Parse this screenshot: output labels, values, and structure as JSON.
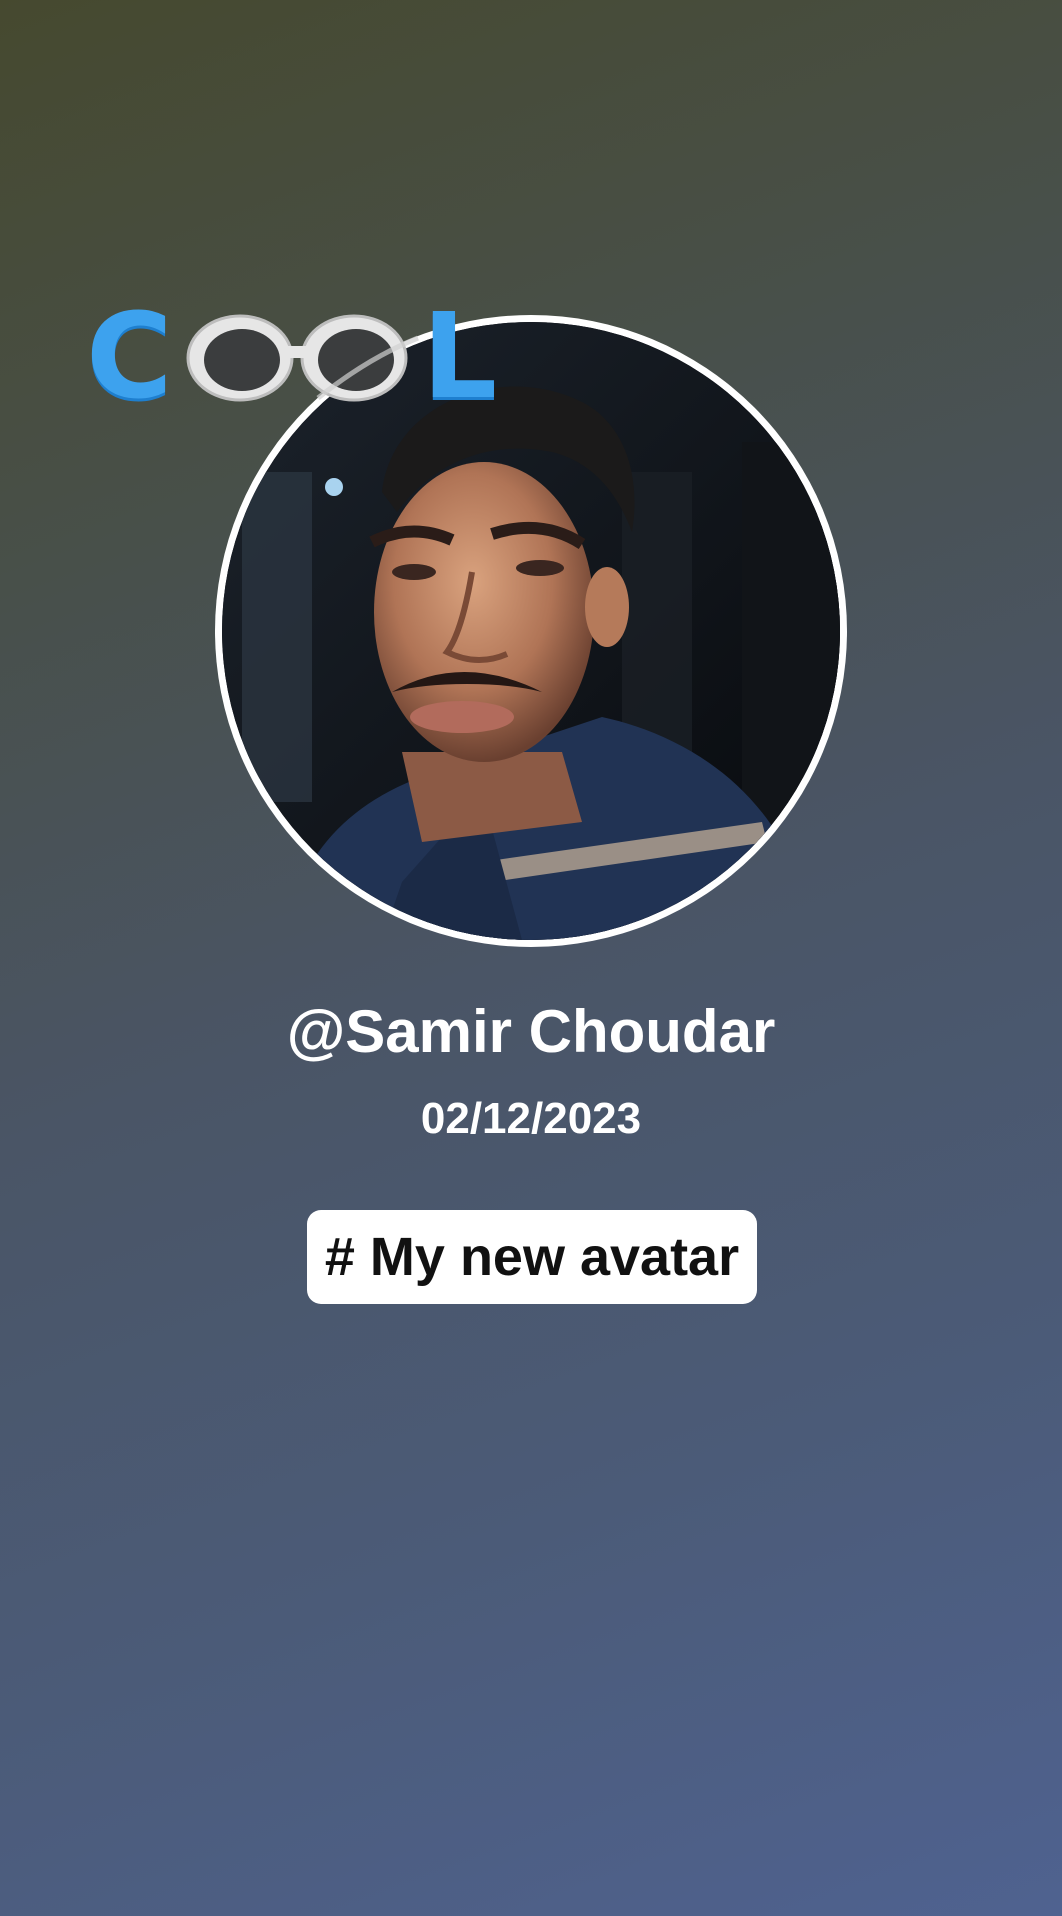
{
  "profile": {
    "username": "@Samir Choudar",
    "date": "02/12/2023",
    "avatar_icon": "user-photo",
    "ring_color": "#ffffff"
  },
  "sticker": {
    "icon": "sunglasses-icon",
    "letter_first": "C",
    "letter_last": "L",
    "color": "#3da2ee"
  },
  "tag": {
    "label": "# My new avatar"
  },
  "theme": {
    "background_top": "#46492f",
    "background_bottom": "#4f6290"
  }
}
